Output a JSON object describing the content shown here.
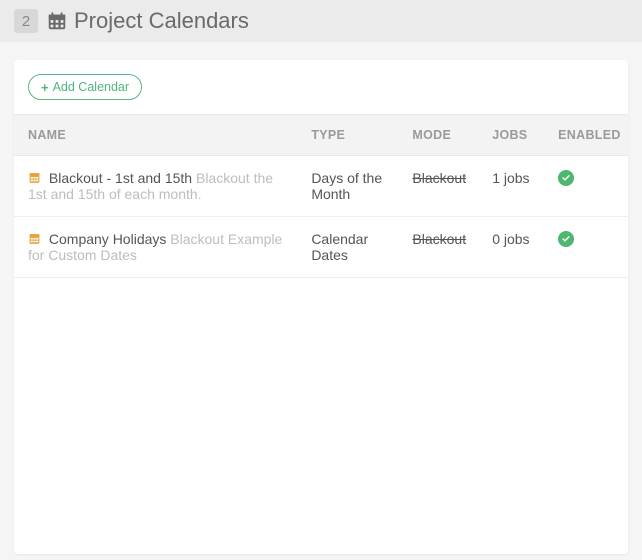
{
  "header": {
    "step": "2",
    "title": "Project Calendars"
  },
  "actions": {
    "add_label": "Add Calendar"
  },
  "table": {
    "columns": {
      "name": "NAME",
      "type": "TYPE",
      "mode": "MODE",
      "jobs": "JOBS",
      "enabled": "ENABLED"
    },
    "rows": [
      {
        "name": "Blackout - 1st and 15th",
        "desc": "Blackout the 1st and 15th of each month.",
        "type": "Days of the Month",
        "mode": "Blackout",
        "jobs": "1 jobs",
        "enabled": true
      },
      {
        "name": "Company Holidays",
        "desc": "Blackout Example for Custom Dates",
        "type": "Calendar Dates",
        "mode": "Blackout",
        "jobs": "0 jobs",
        "enabled": true
      }
    ]
  }
}
